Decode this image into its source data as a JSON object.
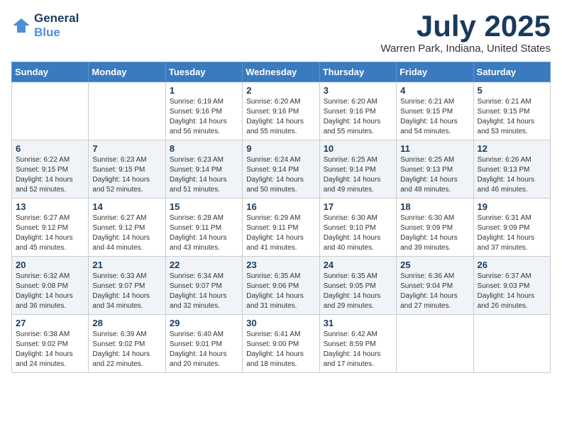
{
  "header": {
    "logo_line1": "General",
    "logo_line2": "Blue",
    "month": "July 2025",
    "location": "Warren Park, Indiana, United States"
  },
  "weekdays": [
    "Sunday",
    "Monday",
    "Tuesday",
    "Wednesday",
    "Thursday",
    "Friday",
    "Saturday"
  ],
  "weeks": [
    [
      {
        "day": "",
        "info": ""
      },
      {
        "day": "",
        "info": ""
      },
      {
        "day": "1",
        "info": "Sunrise: 6:19 AM\nSunset: 9:16 PM\nDaylight: 14 hours and 56 minutes."
      },
      {
        "day": "2",
        "info": "Sunrise: 6:20 AM\nSunset: 9:16 PM\nDaylight: 14 hours and 55 minutes."
      },
      {
        "day": "3",
        "info": "Sunrise: 6:20 AM\nSunset: 9:16 PM\nDaylight: 14 hours and 55 minutes."
      },
      {
        "day": "4",
        "info": "Sunrise: 6:21 AM\nSunset: 9:15 PM\nDaylight: 14 hours and 54 minutes."
      },
      {
        "day": "5",
        "info": "Sunrise: 6:21 AM\nSunset: 9:15 PM\nDaylight: 14 hours and 53 minutes."
      }
    ],
    [
      {
        "day": "6",
        "info": "Sunrise: 6:22 AM\nSunset: 9:15 PM\nDaylight: 14 hours and 52 minutes."
      },
      {
        "day": "7",
        "info": "Sunrise: 6:23 AM\nSunset: 9:15 PM\nDaylight: 14 hours and 52 minutes."
      },
      {
        "day": "8",
        "info": "Sunrise: 6:23 AM\nSunset: 9:14 PM\nDaylight: 14 hours and 51 minutes."
      },
      {
        "day": "9",
        "info": "Sunrise: 6:24 AM\nSunset: 9:14 PM\nDaylight: 14 hours and 50 minutes."
      },
      {
        "day": "10",
        "info": "Sunrise: 6:25 AM\nSunset: 9:14 PM\nDaylight: 14 hours and 49 minutes."
      },
      {
        "day": "11",
        "info": "Sunrise: 6:25 AM\nSunset: 9:13 PM\nDaylight: 14 hours and 48 minutes."
      },
      {
        "day": "12",
        "info": "Sunrise: 6:26 AM\nSunset: 9:13 PM\nDaylight: 14 hours and 46 minutes."
      }
    ],
    [
      {
        "day": "13",
        "info": "Sunrise: 6:27 AM\nSunset: 9:12 PM\nDaylight: 14 hours and 45 minutes."
      },
      {
        "day": "14",
        "info": "Sunrise: 6:27 AM\nSunset: 9:12 PM\nDaylight: 14 hours and 44 minutes."
      },
      {
        "day": "15",
        "info": "Sunrise: 6:28 AM\nSunset: 9:11 PM\nDaylight: 14 hours and 43 minutes."
      },
      {
        "day": "16",
        "info": "Sunrise: 6:29 AM\nSunset: 9:11 PM\nDaylight: 14 hours and 41 minutes."
      },
      {
        "day": "17",
        "info": "Sunrise: 6:30 AM\nSunset: 9:10 PM\nDaylight: 14 hours and 40 minutes."
      },
      {
        "day": "18",
        "info": "Sunrise: 6:30 AM\nSunset: 9:09 PM\nDaylight: 14 hours and 39 minutes."
      },
      {
        "day": "19",
        "info": "Sunrise: 6:31 AM\nSunset: 9:09 PM\nDaylight: 14 hours and 37 minutes."
      }
    ],
    [
      {
        "day": "20",
        "info": "Sunrise: 6:32 AM\nSunset: 9:08 PM\nDaylight: 14 hours and 36 minutes."
      },
      {
        "day": "21",
        "info": "Sunrise: 6:33 AM\nSunset: 9:07 PM\nDaylight: 14 hours and 34 minutes."
      },
      {
        "day": "22",
        "info": "Sunrise: 6:34 AM\nSunset: 9:07 PM\nDaylight: 14 hours and 32 minutes."
      },
      {
        "day": "23",
        "info": "Sunrise: 6:35 AM\nSunset: 9:06 PM\nDaylight: 14 hours and 31 minutes."
      },
      {
        "day": "24",
        "info": "Sunrise: 6:35 AM\nSunset: 9:05 PM\nDaylight: 14 hours and 29 minutes."
      },
      {
        "day": "25",
        "info": "Sunrise: 6:36 AM\nSunset: 9:04 PM\nDaylight: 14 hours and 27 minutes."
      },
      {
        "day": "26",
        "info": "Sunrise: 6:37 AM\nSunset: 9:03 PM\nDaylight: 14 hours and 26 minutes."
      }
    ],
    [
      {
        "day": "27",
        "info": "Sunrise: 6:38 AM\nSunset: 9:02 PM\nDaylight: 14 hours and 24 minutes."
      },
      {
        "day": "28",
        "info": "Sunrise: 6:39 AM\nSunset: 9:02 PM\nDaylight: 14 hours and 22 minutes."
      },
      {
        "day": "29",
        "info": "Sunrise: 6:40 AM\nSunset: 9:01 PM\nDaylight: 14 hours and 20 minutes."
      },
      {
        "day": "30",
        "info": "Sunrise: 6:41 AM\nSunset: 9:00 PM\nDaylight: 14 hours and 18 minutes."
      },
      {
        "day": "31",
        "info": "Sunrise: 6:42 AM\nSunset: 8:59 PM\nDaylight: 14 hours and 17 minutes."
      },
      {
        "day": "",
        "info": ""
      },
      {
        "day": "",
        "info": ""
      }
    ]
  ]
}
